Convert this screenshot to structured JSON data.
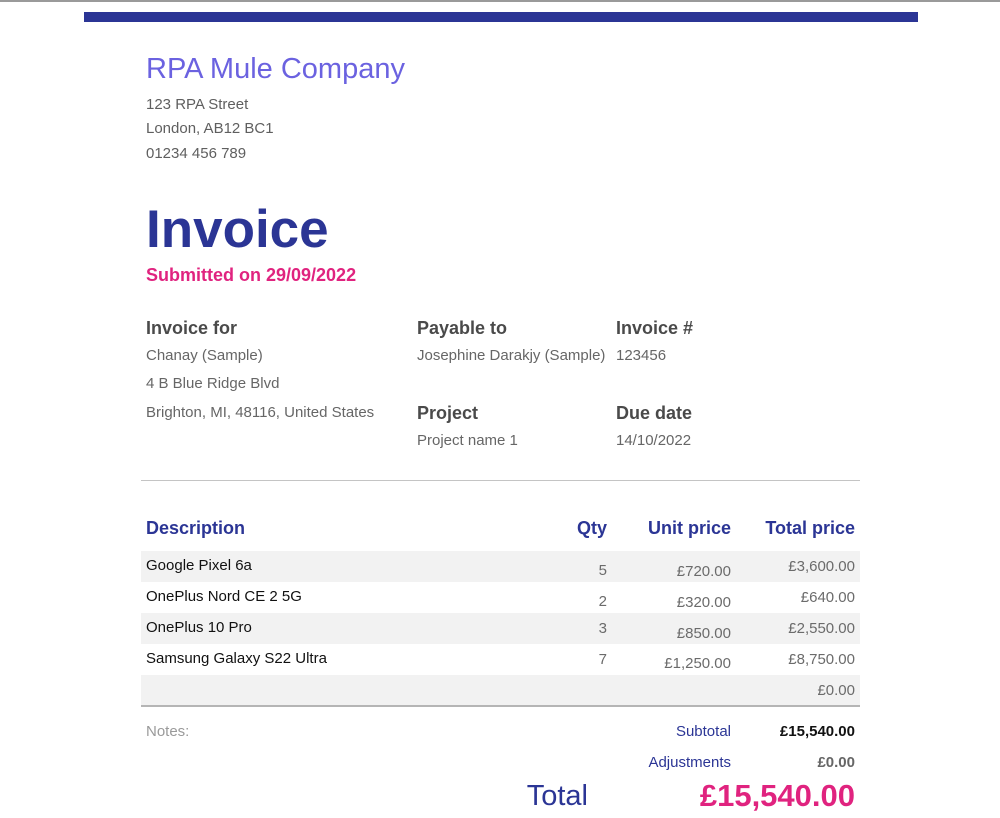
{
  "company": {
    "name": "RPA Mule Company",
    "street": "123 RPA Street",
    "city": "London, AB12 BC1",
    "phone": "01234 456 789"
  },
  "invoice": {
    "title": "Invoice",
    "submitted": "Submitted on 29/09/2022"
  },
  "billing": {
    "invoice_for_label": "Invoice for",
    "client_name": "Chanay (Sample)",
    "client_address1": "4 B Blue Ridge Blvd",
    "client_address2": "Brighton, MI, 48116, United States",
    "payable_to_label": "Payable to",
    "payable_to": "Josephine Darakjy (Sample)",
    "invoice_no_label": "Invoice #",
    "invoice_no": "123456",
    "project_label": "Project",
    "project": "Project name 1",
    "due_date_label": "Due date",
    "due_date": "14/10/2022"
  },
  "table": {
    "headers": {
      "description": "Description",
      "qty": "Qty",
      "unit_price": "Unit price",
      "total_price": "Total price"
    },
    "rows": [
      {
        "description": "Google Pixel 6a",
        "qty": "5",
        "unit_price": "£720.00",
        "total_price": "£3,600.00"
      },
      {
        "description": "OnePlus Nord CE 2 5G",
        "qty": "2",
        "unit_price": "£320.00",
        "total_price": "£640.00"
      },
      {
        "description": "OnePlus 10 Pro",
        "qty": "3",
        "unit_price": "£850.00",
        "total_price": "£2,550.00"
      },
      {
        "description": "Samsung Galaxy S22 Ultra",
        "qty": "7",
        "unit_price": "£1,250.00",
        "total_price": "£8,750.00"
      },
      {
        "description": "",
        "qty": "",
        "unit_price": "",
        "total_price": "£0.00"
      }
    ]
  },
  "summary": {
    "notes_label": "Notes:",
    "subtotal_label": "Subtotal",
    "subtotal": "£15,540.00",
    "adjustments_label": "Adjustments",
    "adjustments": "£0.00",
    "total_label": "Total",
    "total": "£15,540.00"
  },
  "colors": {
    "brand_navy": "#2b3595",
    "brand_pink": "#e0237f",
    "company_purple": "#6b62e0"
  }
}
